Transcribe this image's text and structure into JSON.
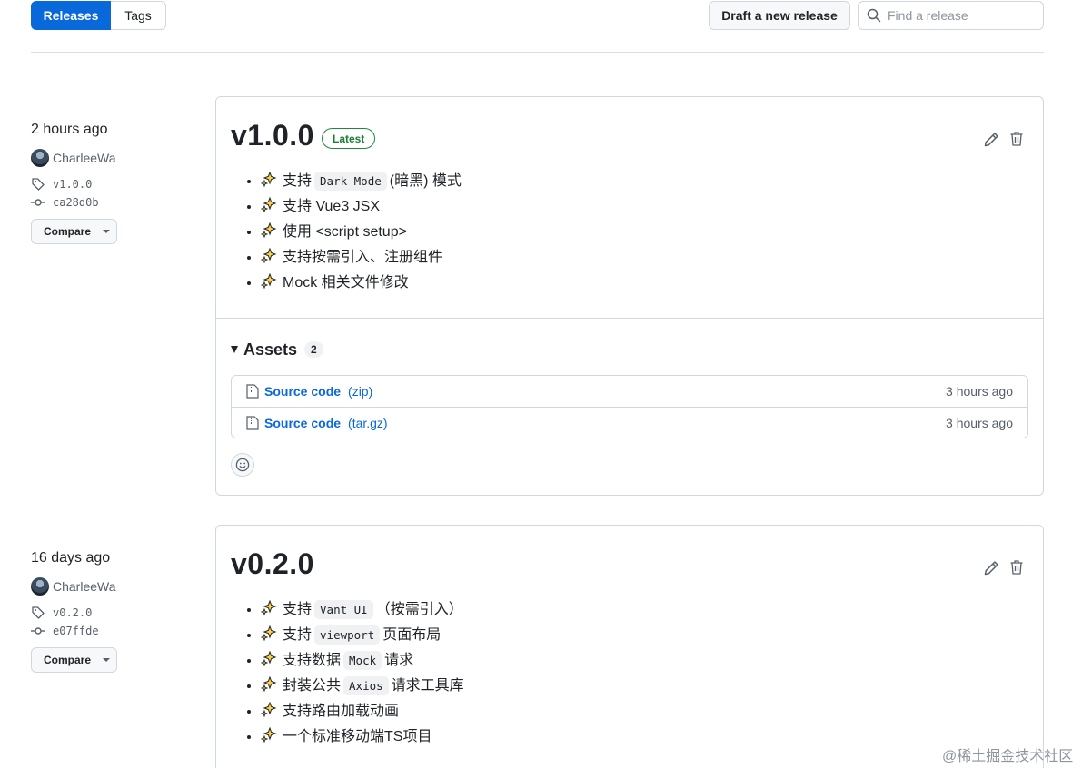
{
  "nav": {
    "releases_tab": "Releases",
    "tags_tab": "Tags"
  },
  "toolbar": {
    "draft_label": "Draft a new release",
    "search_placeholder": "Find a release"
  },
  "releases": [
    {
      "time": "2 hours ago",
      "author": "CharleeWa",
      "tag": "v1.0.0",
      "commit": "ca28d0b",
      "compare_label": "Compare",
      "version": "v1.0.0",
      "badge": "Latest",
      "notes": [
        {
          "pre": "支持",
          "code": "Dark Mode",
          "post": "(暗黑) 模式"
        },
        {
          "pre": "支持 Vue3 JSX",
          "code": "",
          "post": ""
        },
        {
          "pre": "使用 <script setup>",
          "code": "",
          "post": ""
        },
        {
          "pre": "支持按需引入、注册组件",
          "code": "",
          "post": ""
        },
        {
          "pre": "Mock 相关文件修改",
          "code": "",
          "post": ""
        }
      ],
      "assets_label": "Assets",
      "assets_count": "2",
      "assets": [
        {
          "name": "Source code",
          "format": "(zip)",
          "time": "3 hours ago"
        },
        {
          "name": "Source code",
          "format": "(tar.gz)",
          "time": "3 hours ago"
        }
      ]
    },
    {
      "time": "16 days ago",
      "author": "CharleeWa",
      "tag": "v0.2.0",
      "commit": "e07ffde",
      "compare_label": "Compare",
      "version": "v0.2.0",
      "notes": [
        {
          "pre": "支持",
          "code": "Vant UI",
          "post": "（按需引入）"
        },
        {
          "pre": "支持",
          "code": "viewport",
          "post": "页面布局"
        },
        {
          "pre": "支持数据",
          "code": "Mock",
          "post": "请求"
        },
        {
          "pre": "封装公共",
          "code": "Axios",
          "post": "请求工具库"
        },
        {
          "pre": "支持路由加载动画",
          "code": "",
          "post": ""
        },
        {
          "pre": "一个标准移动端TS项目",
          "code": "",
          "post": ""
        }
      ]
    }
  ],
  "watermark": "@稀土掘金技术社区"
}
